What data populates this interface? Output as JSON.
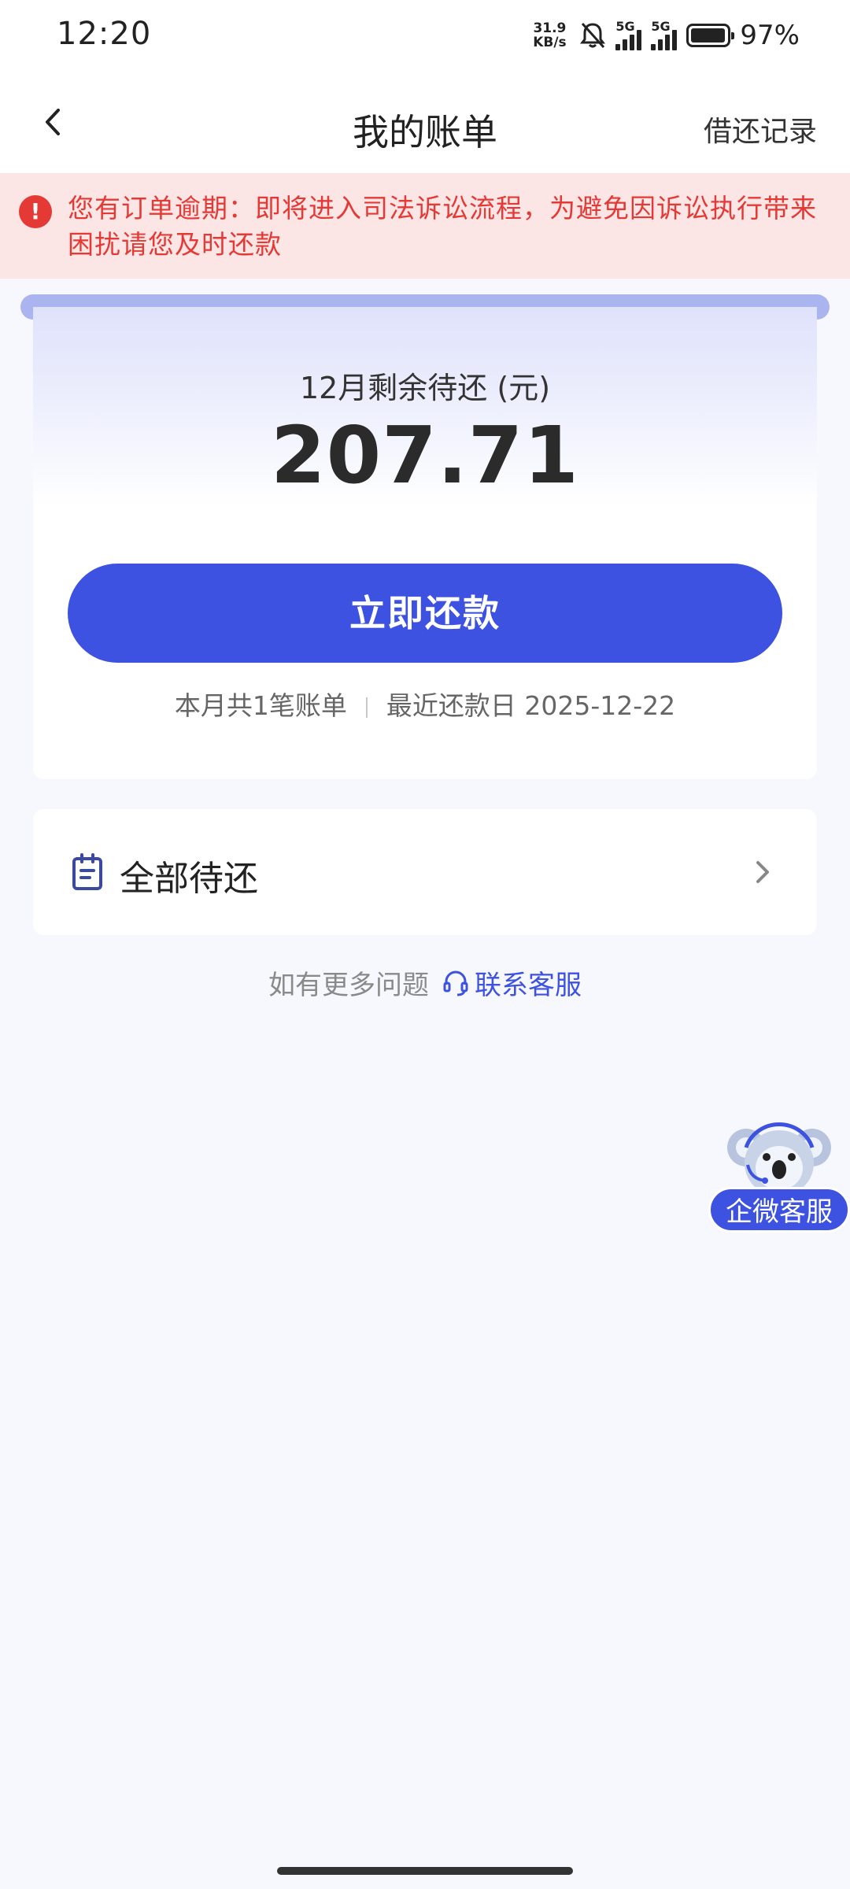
{
  "status_bar": {
    "time": "12:20",
    "net_speed_value": "31.9",
    "net_speed_unit": "KB/s",
    "signal_1_label": "5G",
    "signal_2_label": "5G",
    "battery_percent": "97%",
    "battery_level": 0.97
  },
  "nav": {
    "title": "我的账单",
    "right_link": "借还记录"
  },
  "warning": {
    "text": "您有订单逾期：即将进入司法诉讼流程，为避免因诉讼执行带来困扰请您及时还款",
    "color": "#e53935"
  },
  "summary": {
    "label": "12月剩余待还 (元)",
    "amount": "207.71",
    "pay_button": "立即还款",
    "bill_count": "本月共1笔账单",
    "due_date": "最近还款日 2025-12-22",
    "accent_color": "#3d52e0"
  },
  "all_pending": {
    "label": "全部待还"
  },
  "help": {
    "prefix": "如有更多问题",
    "link": "联系客服"
  },
  "float_service": {
    "label": "企微客服"
  }
}
